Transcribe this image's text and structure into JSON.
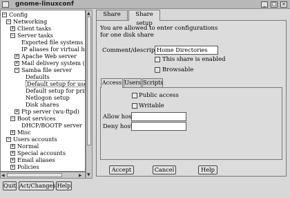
{
  "window": {
    "title": "gnome-linuxconf",
    "icons": {
      "menu": "window-menu-icon",
      "minimize": "minimize-icon",
      "maximize": "maximize-icon",
      "close": "close-icon"
    }
  },
  "tree": {
    "items": [
      {
        "label": "Config",
        "expander": "−"
      },
      {
        "label": "Networking",
        "expander": "−"
      },
      {
        "label": "Client tasks",
        "expander": "+"
      },
      {
        "label": "Server tasks",
        "expander": "−"
      },
      {
        "label": "Exported file systems (NFS"
      },
      {
        "label": "IP aliases for virtual hosts"
      },
      {
        "label": "Apache Web server",
        "expander": "+"
      },
      {
        "label": "Mail delivery system (sendi",
        "expander": "+"
      },
      {
        "label": "Samba file server",
        "expander": "−"
      },
      {
        "label": "Defaults"
      },
      {
        "label": "Default setup for users's h",
        "selected": true
      },
      {
        "label": "Default setup for printers"
      },
      {
        "label": "Netlogon setup"
      },
      {
        "label": "Disk shares"
      },
      {
        "label": "Ftp server (wu-ftpd)",
        "expander": "+"
      },
      {
        "label": "Boot services",
        "expander": "−"
      },
      {
        "label": "DHCP/BOOTP server"
      },
      {
        "label": "Misc",
        "expander": "+"
      },
      {
        "label": "Users accounts",
        "expander": "−"
      },
      {
        "label": "Normal",
        "expander": "+"
      },
      {
        "label": "Special accounts",
        "expander": "+"
      },
      {
        "label": "Email aliases",
        "expander": "+"
      },
      {
        "label": "Policies",
        "expander": "+"
      }
    ]
  },
  "bottom_buttons": {
    "quit": "Quit",
    "act_changes": "Act/Changes",
    "help": "Help"
  },
  "tabs": {
    "share_setup_1": "Share setup",
    "share_setup_2": "Share setup"
  },
  "form": {
    "intro_line1": "You are allowed to enter configurations",
    "intro_line2": "for one disk share",
    "comment_label": "Comment/description",
    "comment_value": "Home Directories",
    "share_enabled_label": "This share is enabled",
    "browsable_label": "Browsable"
  },
  "inner_tabs": {
    "access": "Access",
    "users": "Users",
    "scripts": "Scripts"
  },
  "access": {
    "public_access_label": "Public access",
    "writable_label": "Writable",
    "allow_hosts_label": "Allow hosts",
    "allow_hosts_value": "",
    "deny_hosts_label": "Deny hosts",
    "deny_hosts_value": ""
  },
  "dialog_buttons": {
    "accept": "Accept",
    "cancel": "Cancel",
    "help": "Help"
  }
}
